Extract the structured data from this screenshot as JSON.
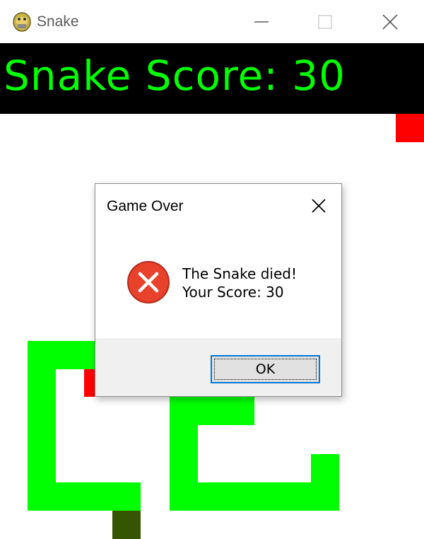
{
  "window": {
    "title": "Snake",
    "icon": "python-icon",
    "controls": [
      "minimize-icon",
      "maximize-icon",
      "close-icon"
    ]
  },
  "scorebar": {
    "text": "Snake Score: 30"
  },
  "game": {
    "snake_color": "#00ff00",
    "tail_color": "#365502",
    "food_color": "#ff0000",
    "background": "#ffffff"
  },
  "dialog": {
    "title": "Game Over",
    "icon": "error-icon",
    "message_line1": "The Snake died!",
    "message_line2": "Your Score: 30",
    "ok_label": "OK"
  }
}
